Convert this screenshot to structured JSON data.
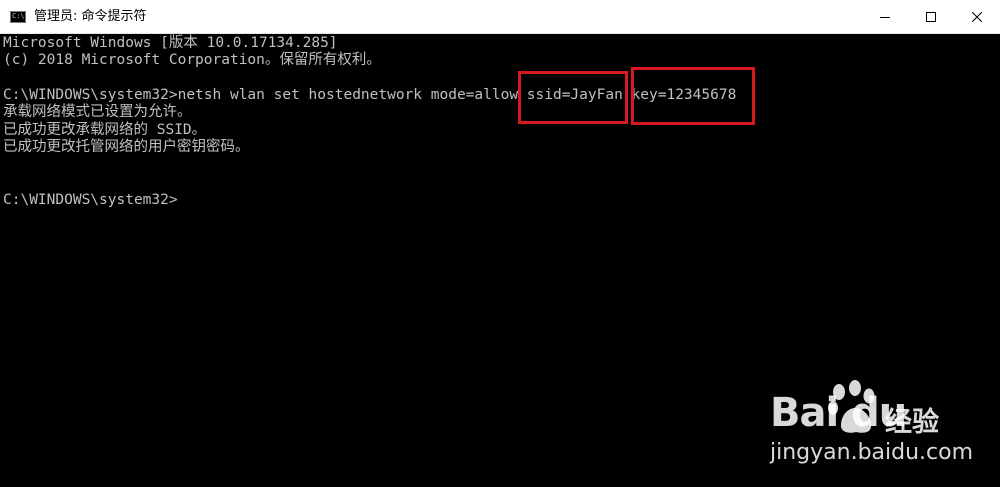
{
  "window": {
    "title": "管理员: 命令提示符",
    "icon_label": "C:\\"
  },
  "terminal": {
    "lines": [
      "Microsoft Windows [版本 10.0.17134.285]",
      "(c) 2018 Microsoft Corporation。保留所有权利。",
      "",
      "C:\\WINDOWS\\system32>netsh wlan set hostednetwork mode=allow ssid=JayFan key=12345678",
      "承载网络模式已设置为允许。",
      "已成功更改承载网络的 SSID。",
      "已成功更改托管网络的用户密钥密码。",
      "",
      "",
      "C:\\WINDOWS\\system32>"
    ]
  },
  "colors": {
    "terminal_bg": "#000000",
    "terminal_fg": "#c0c0c0",
    "highlight": "#d71920"
  },
  "watermark": {
    "brand": "Bai  du",
    "cn": "经验",
    "url": "jingyan.baidu.com"
  }
}
